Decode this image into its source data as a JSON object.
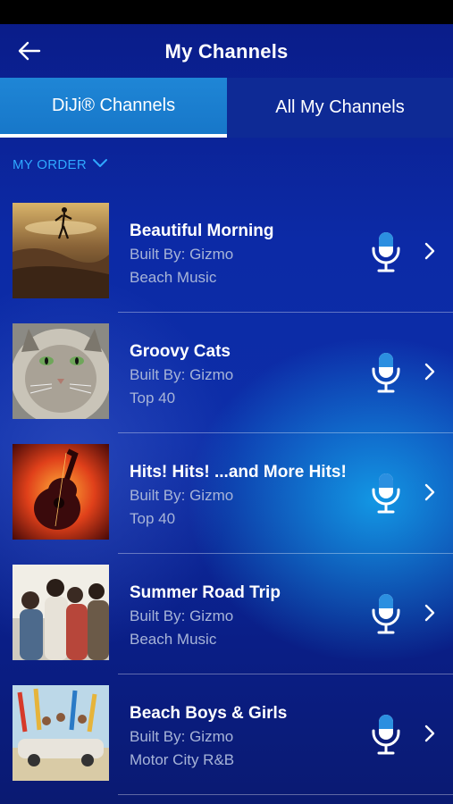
{
  "header": {
    "title": "My Channels",
    "back_icon": "arrow-left-icon"
  },
  "tabs": [
    {
      "label": "DiJi® Channels",
      "active": true
    },
    {
      "label": "All My Channels",
      "active": false
    }
  ],
  "sort": {
    "label": "MY ORDER",
    "icon": "chevron-down-icon"
  },
  "channels": [
    {
      "name": "Beautiful Morning",
      "builder": "Built By: Gizmo",
      "genre": "Beach Music"
    },
    {
      "name": "Groovy Cats",
      "builder": "Built By: Gizmo",
      "genre": "Top 40"
    },
    {
      "name": "Hits! Hits! ...and More Hits!",
      "builder": "Built By: Gizmo",
      "genre": "Top 40"
    },
    {
      "name": "Summer Road Trip",
      "builder": "Built By: Gizmo",
      "genre": "Beach Music"
    },
    {
      "name": "Beach Boys & Girls",
      "builder": "Built By: Gizmo",
      "genre": "Motor City R&B"
    }
  ],
  "colors": {
    "accent": "#2fa8ff",
    "active_tab": "#1b7fd0",
    "mic_accent": "#2b8fe0"
  }
}
